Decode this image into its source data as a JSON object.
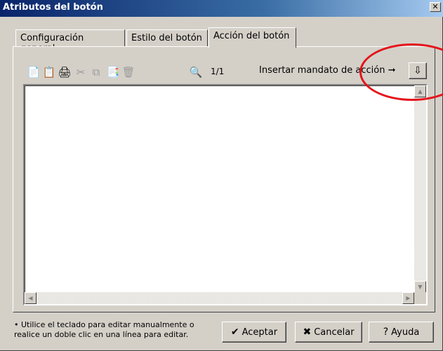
{
  "window": {
    "title": "Atributos del botón",
    "close": "✕"
  },
  "tabs": [
    {
      "label": "Configuración general"
    },
    {
      "label": "Estilo del botón"
    },
    {
      "label": "Acción del botón"
    }
  ],
  "toolbar": {
    "icons": [
      "📄",
      "📋",
      "🖨",
      "✂",
      "⧉",
      "📑",
      "🗑",
      "🔍"
    ],
    "page_count": "1/1",
    "insert_label": "Insertar mandato de acción ➞",
    "insert_icon": "⇩"
  },
  "editor": {
    "content": ""
  },
  "footer": {
    "hint_line1": "• Utilice el teclado para editar manualmente o",
    "hint_line2": "realice un doble clic en una línea para editar.",
    "accept_label": "Aceptar",
    "cancel_label": "Cancelar",
    "help_label": "Ayuda",
    "accept_icon": "✔",
    "cancel_icon": "✖",
    "help_icon": "?"
  },
  "colors": {
    "titlebar": "#0a246a",
    "highlight": "#e4141b",
    "face": "#d4d0c8"
  }
}
